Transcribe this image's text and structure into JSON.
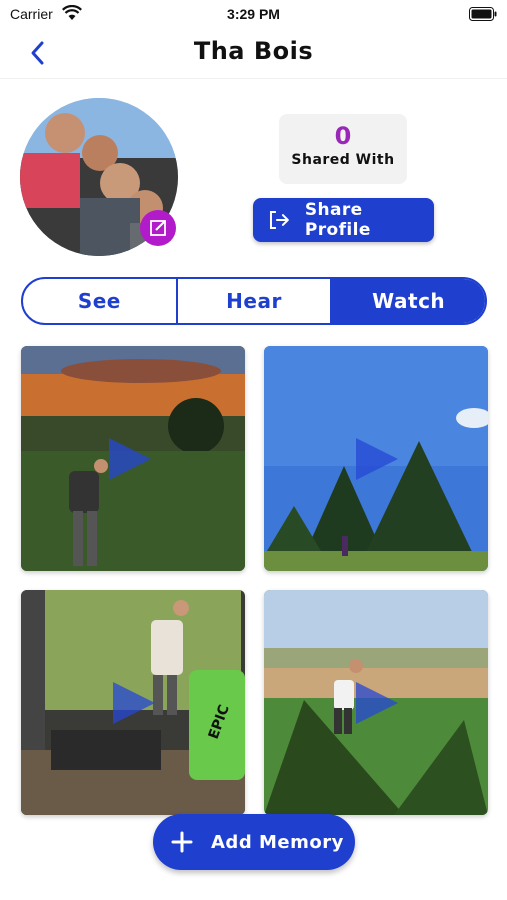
{
  "status_bar": {
    "carrier": "Carrier",
    "time": "3:29 PM"
  },
  "nav": {
    "title": "Tha Bois",
    "back_icon": "chevron-left-icon"
  },
  "profile": {
    "shared_count": "0",
    "shared_label": "Shared With",
    "share_button_label": "Share Profile",
    "edit_icon": "edit-icon"
  },
  "tabs": [
    {
      "label": "See",
      "active": false
    },
    {
      "label": "Hear",
      "active": false
    },
    {
      "label": "Watch",
      "active": true
    }
  ],
  "media": [
    {
      "type": "video",
      "icon": "play-icon"
    },
    {
      "type": "video",
      "icon": "play-icon"
    },
    {
      "type": "video",
      "icon": "play-icon"
    },
    {
      "type": "video",
      "icon": "play-icon"
    }
  ],
  "add_memory_label": "Add Memory",
  "colors": {
    "primary": "#1f3fcf",
    "accent_purple": "#b21bc9",
    "count_purple": "#9a27b6"
  }
}
